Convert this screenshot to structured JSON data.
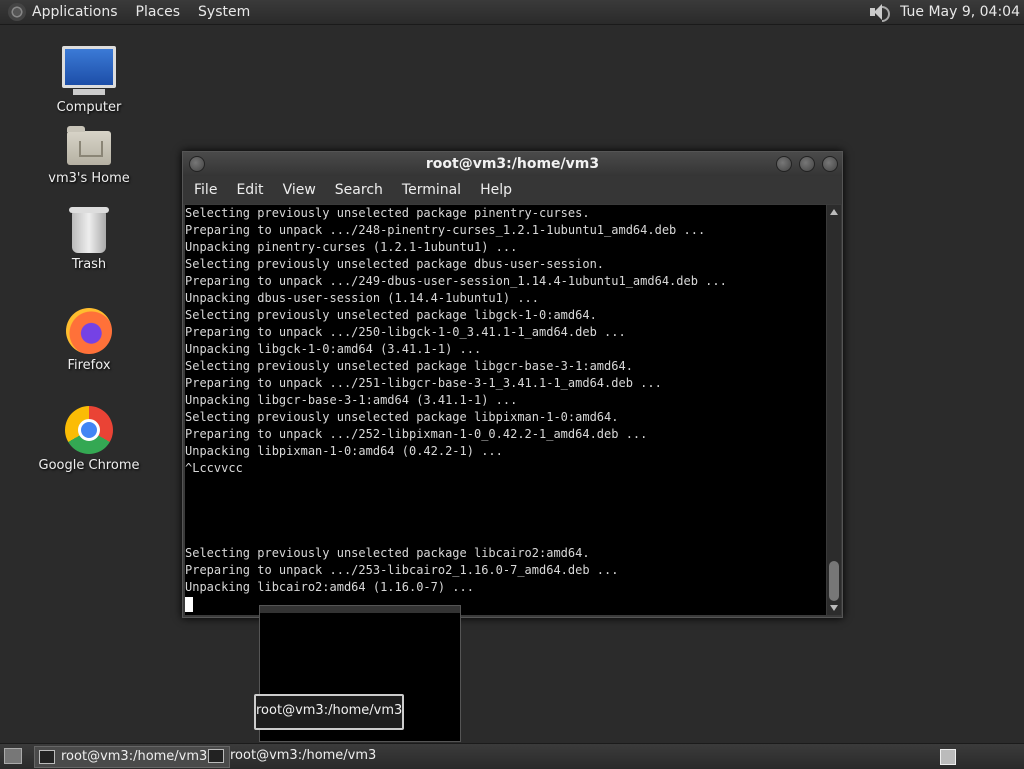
{
  "top_panel": {
    "menus": [
      "Applications",
      "Places",
      "System"
    ],
    "clock": "Tue May  9, 04:04",
    "icons": {
      "logo": "gnome-foot-icon",
      "volume": "speaker-icon"
    }
  },
  "desktop_icons": [
    {
      "label": "Computer",
      "icon": "computer-icon"
    },
    {
      "label": "vm3's Home",
      "icon": "home-folder-icon"
    },
    {
      "label": "Trash",
      "icon": "trash-icon"
    },
    {
      "label": "Firefox",
      "icon": "firefox-icon"
    },
    {
      "label": "Google Chrome",
      "icon": "chrome-icon"
    }
  ],
  "window": {
    "title": "root@vm3:/home/vm3",
    "menu": [
      "File",
      "Edit",
      "View",
      "Search",
      "Terminal",
      "Help"
    ],
    "terminal_lines": [
      "Selecting previously unselected package pinentry-curses.",
      "Preparing to unpack .../248-pinentry-curses_1.2.1-1ubuntu1_amd64.deb ...",
      "Unpacking pinentry-curses (1.2.1-1ubuntu1) ...",
      "Selecting previously unselected package dbus-user-session.",
      "Preparing to unpack .../249-dbus-user-session_1.14.4-1ubuntu1_amd64.deb ...",
      "Unpacking dbus-user-session (1.14.4-1ubuntu1) ...",
      "Selecting previously unselected package libgck-1-0:amd64.",
      "Preparing to unpack .../250-libgck-1-0_3.41.1-1_amd64.deb ...",
      "Unpacking libgck-1-0:amd64 (3.41.1-1) ...",
      "Selecting previously unselected package libgcr-base-3-1:amd64.",
      "Preparing to unpack .../251-libgcr-base-3-1_3.41.1-1_amd64.deb ...",
      "Unpacking libgcr-base-3-1:amd64 (3.41.1-1) ...",
      "Selecting previously unselected package libpixman-1-0:amd64.",
      "Preparing to unpack .../252-libpixman-1-0_0.42.2-1_amd64.deb ...",
      "Unpacking libpixman-1-0:amd64 (0.42.2-1) ...",
      "^Lccvvcc",
      "",
      "",
      "",
      "",
      "Selecting previously unselected package libcairo2:amd64.",
      "Preparing to unpack .../253-libcairo2_1.16.0-7_amd64.deb ...",
      "Unpacking libcairo2:amd64 (1.16.0-7) ..."
    ]
  },
  "tooltip": "root@vm3:/home/vm3",
  "taskbar": {
    "items": [
      {
        "label": "root@vm3:/home/vm3",
        "active": true
      },
      {
        "label": "root@vm3:/home/vm3",
        "active": false
      }
    ]
  }
}
